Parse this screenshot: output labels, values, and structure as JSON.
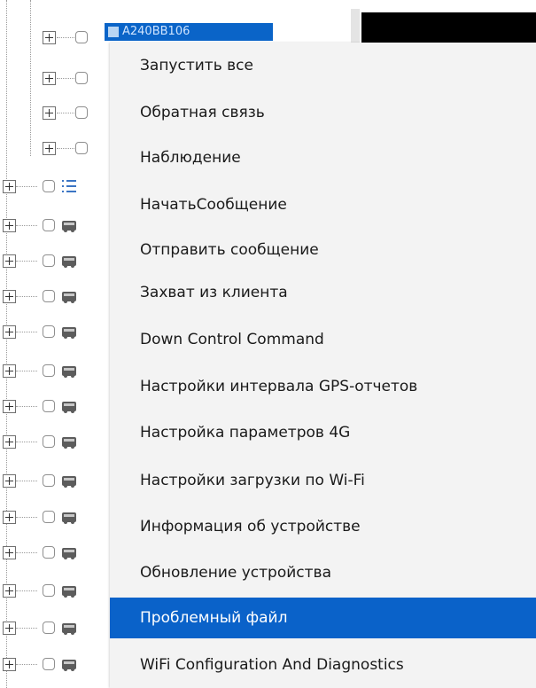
{
  "tree": {
    "selected_node_label": "A240BB106"
  },
  "context_menu": {
    "items": [
      {
        "label": "Запустить все"
      },
      {
        "label": "Обратная связь"
      },
      {
        "label": "Наблюдение"
      },
      {
        "label": "НачатьСообщение"
      },
      {
        "label": "Отправить сообщение"
      },
      {
        "label": "Захват из клиента"
      },
      {
        "label": "Down Control Command"
      },
      {
        "label": "Настройки интервала GPS-отчетов"
      },
      {
        "label": "Настройка параметров 4G"
      },
      {
        "label": "Настройки загрузки по Wi-Fi"
      },
      {
        "label": "Информация об устройстве"
      },
      {
        "label": "Обновление устройства"
      },
      {
        "label": "Проблемный файл"
      },
      {
        "label": "WiFi Configuration And Diagnostics"
      }
    ],
    "selected_index": 12,
    "highlight_color": "#0a62c9"
  },
  "icons": {
    "expand": "plus-box-icon",
    "checkbox": "checkbox-icon",
    "vehicle": "bus-icon",
    "list": "list-icon"
  }
}
